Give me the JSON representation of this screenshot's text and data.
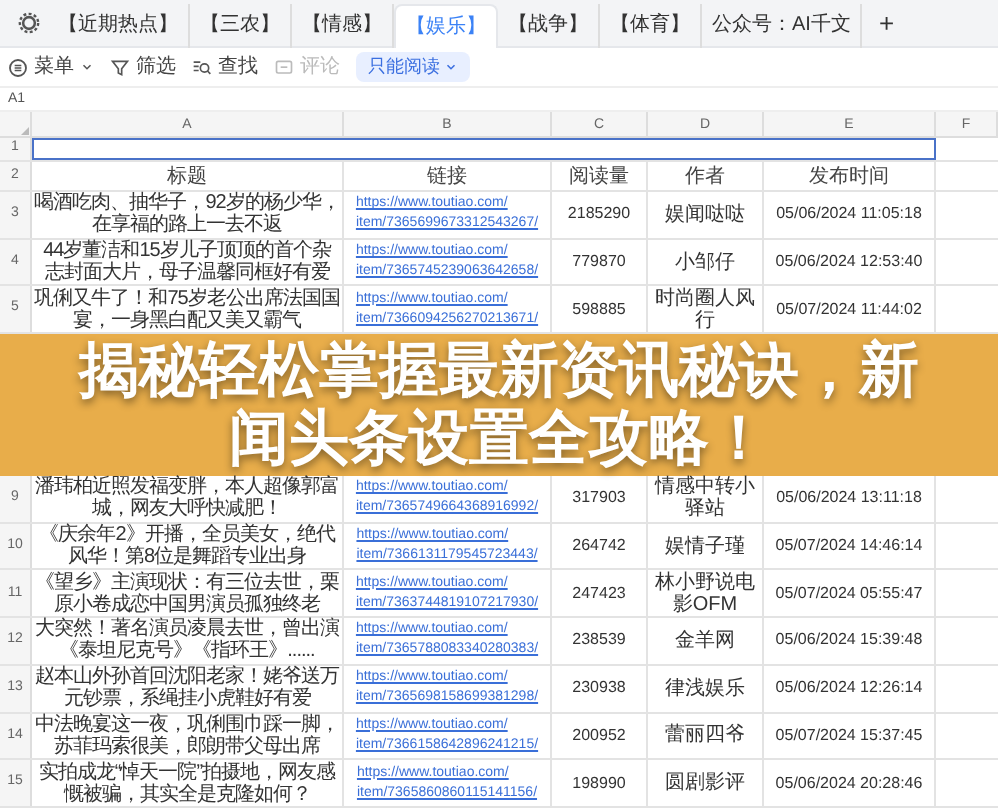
{
  "tabs": [
    {
      "label": "【近期热点】",
      "selected": false
    },
    {
      "label": "【三农】",
      "selected": false
    },
    {
      "label": "【情感】",
      "selected": false
    },
    {
      "label": "【娱乐】",
      "selected": true
    },
    {
      "label": "【战争】",
      "selected": false
    },
    {
      "label": "【体育】",
      "selected": false
    },
    {
      "label": "公众号：AI千文",
      "selected": false
    }
  ],
  "add_tab": "+",
  "toolbar": [
    {
      "kind": "menu",
      "label": "菜单",
      "disabled": false
    },
    {
      "kind": "filter",
      "label": "筛选",
      "disabled": false
    },
    {
      "kind": "find",
      "label": "查找",
      "disabled": false
    },
    {
      "kind": "comment",
      "label": "评论",
      "disabled": true
    },
    {
      "kind": "mode",
      "label": "只能阅读",
      "disabled": false
    }
  ],
  "cell_ref": "A1",
  "columns": [
    "A",
    "B",
    "C",
    "D",
    "E",
    "F"
  ],
  "title_range_selected": true,
  "rows": [
    {
      "number": "1",
      "kind": "blank"
    },
    {
      "number": "2",
      "kind": "header",
      "cells": [
        "标题",
        "链接",
        "阅读量",
        "作者",
        "发布时间"
      ]
    },
    {
      "number": "3",
      "kind": "data",
      "title": "喝酒吃肉、抽华子，92岁的杨少华，在享福的路上一去不返",
      "link_lines": [
        "https://www.toutiao.com/",
        "item/7365699673312543267/"
      ],
      "reads": "2185290",
      "author": "娱闻哒哒",
      "time": "05/06/2024 11:05:18"
    },
    {
      "number": "4",
      "kind": "data",
      "title": "44岁董洁和15岁儿子顶顶的首个杂志封面大片，母子温馨同框好有爱",
      "link_lines": [
        "https://www.toutiao.com/",
        "item/7365745239063642658/"
      ],
      "reads": "779870",
      "author": "小邹仔",
      "time": "05/06/2024 12:53:40"
    },
    {
      "number": "5",
      "kind": "data",
      "title": "巩俐又牛了！和75岁老公出席法国国宴，一身黑白配又美又霸气",
      "link_lines": [
        "https://www.toutiao.com/",
        "item/7366094256270213671/"
      ],
      "reads": "598885",
      "author": "时尚圈人风行",
      "time": "05/07/2024 11:44:02"
    }
  ],
  "banner": {
    "title": "揭秘轻松掌握最新资讯秘诀，新闻头条设置全攻略！"
  },
  "rows_below": [
    {
      "number": "9",
      "kind": "data",
      "title": "潘玮柏近照发福变胖，本人超像郭富城，网友大呼快减肥！",
      "link_lines": [
        "https://www.toutiao.com/",
        "item/7365749664368916992/"
      ],
      "reads": "317903",
      "author": "情感中转小驿站",
      "time": "05/06/2024 13:11:18"
    },
    {
      "number": "10",
      "kind": "data",
      "title": "《庆余年2》开播，全员美女，绝代风华！第8位是舞蹈专业出身",
      "link_lines": [
        "https://www.toutiao.com/",
        "item/7366131179545723443/"
      ],
      "reads": "264742",
      "author": "娱情子瑾",
      "time": "05/07/2024 14:46:14"
    },
    {
      "number": "11",
      "kind": "data",
      "title": "《望乡》主演现状：有三位去世，栗原小卷成恋中国男演员孤独终老",
      "link_lines": [
        "https://www.toutiao.com/",
        "item/7363744819107217930/"
      ],
      "reads": "247423",
      "author": "林小野说电影OFM",
      "time": "05/07/2024 05:55:47"
    },
    {
      "number": "12",
      "kind": "data",
      "title": "大突然！著名演员凌晨去世，曾出演《泰坦尼克号》《指环王》......",
      "link_lines": [
        "https://www.toutiao.com/",
        "item/7365788083340280383/"
      ],
      "reads": "238539",
      "author": "金羊网",
      "time": "05/06/2024 15:39:48"
    },
    {
      "number": "13",
      "kind": "data",
      "title": "赵本山外孙首回沈阳老家！姥爷送万元钞票，系绳挂小虎鞋好有爱",
      "link_lines": [
        "https://www.toutiao.com/",
        "item/7365698158699381298/"
      ],
      "reads": "230938",
      "author": "律浅娱乐",
      "time": "05/06/2024 12:26:14"
    },
    {
      "number": "14",
      "kind": "data",
      "title": "中法晚宴这一夜，巩俐围巾踩一脚，苏菲玛索很美，郎朗带父母出席",
      "link_lines": [
        "https://www.toutiao.com/",
        "item/7366158642896241215/"
      ],
      "reads": "200952",
      "author": "蕾丽四爷",
      "time": "05/07/2024 15:37:45"
    },
    {
      "number": "15",
      "kind": "data",
      "title": "实拍成龙“悼天一院”拍摄地，网友感慨被骗，其实全是克隆如何？",
      "link_lines": [
        "https://www.toutiao.com/",
        "item/7365860860115141156/"
      ],
      "reads": "198990",
      "author": "圆剧影评",
      "time": "05/06/2024 20:28:46"
    }
  ]
}
